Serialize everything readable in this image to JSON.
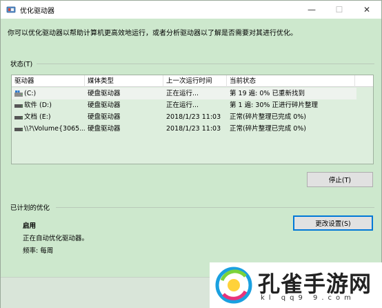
{
  "window": {
    "title": "优化驱动器",
    "controls": {
      "minimize": "—",
      "maximize": "☐",
      "close": "✕"
    }
  },
  "description": "你可以优化驱动器以帮助计算机更高效地运行，或者分析驱动器以了解是否需要对其进行优化。",
  "status": {
    "label": "状态(T)",
    "columns": [
      "驱动器",
      "媒体类型",
      "上一次运行时间",
      "当前状态"
    ],
    "rows": [
      {
        "drive": "(C:)",
        "media": "硬盘驱动器",
        "last_run": "正在运行...",
        "status": "第 19 遍: 0% 已重新找到",
        "icon": "windows-drive-icon"
      },
      {
        "drive": "软件 (D:)",
        "media": "硬盘驱动器",
        "last_run": "正在运行...",
        "status": "第 1 遍: 30% 正进行碎片整理",
        "icon": "hard-drive-icon"
      },
      {
        "drive": "文档 (E:)",
        "media": "硬盘驱动器",
        "last_run": "2018/1/23 11:03",
        "status": "正常(碎片整理已完成 0%)",
        "icon": "hard-drive-icon"
      },
      {
        "drive": "\\\\?\\Volume{3065...",
        "media": "硬盘驱动器",
        "last_run": "2018/1/23 11:03",
        "status": "正常(碎片整理已完成 0%)",
        "icon": "hard-drive-icon"
      }
    ],
    "stop_button": "停止(T)"
  },
  "scheduled": {
    "label": "已计划的优化",
    "state": "启用",
    "detail": "正在自动优化驱动器。",
    "frequency": "频率: 每周",
    "change_button": "更改设置(S)"
  },
  "watermark": {
    "title": "孔雀手游网",
    "url": "kl qq9 9.com"
  },
  "colors": {
    "window_bg": "#cde8cd",
    "table_bg": "#ddeedd",
    "accent_border": "#0078d7"
  }
}
